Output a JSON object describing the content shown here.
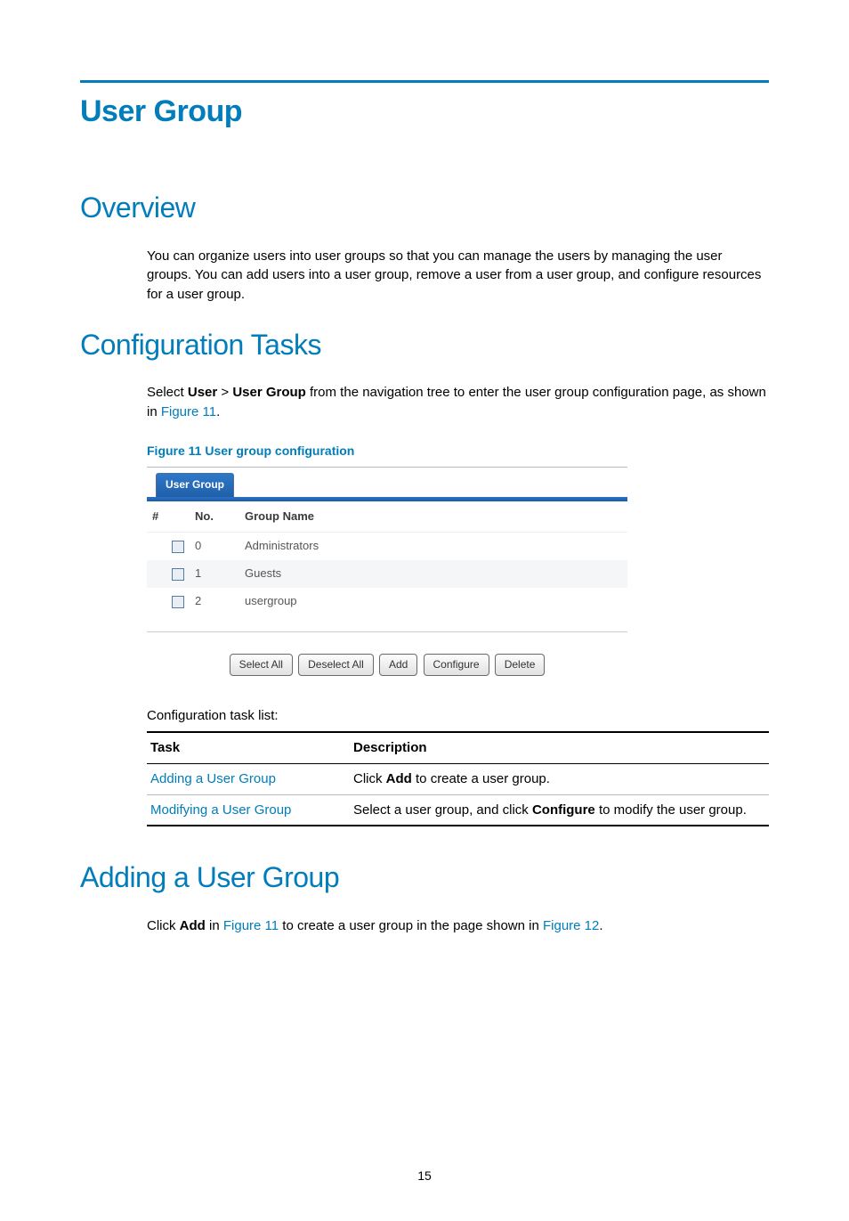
{
  "pageTitle": "User Group",
  "overview": {
    "heading": "Overview",
    "text": "You can organize users into user groups so that you can manage the users by managing the user groups. You can add users into a user group, remove a user from a user group, and configure resources for a user group."
  },
  "config": {
    "heading": "Configuration Tasks",
    "introPre": "Select ",
    "introBold1": "User",
    "introGt": " > ",
    "introBold2": "User Group",
    "introMid": " from the navigation tree to enter the user group configuration page, as shown in ",
    "introLink": "Figure 11",
    "introEnd": ".",
    "figureCaption": "Figure 11 User group configuration",
    "tabLabel": "User Group",
    "columns": {
      "hash": "#",
      "no": "No.",
      "name": "Group Name"
    },
    "rows": [
      {
        "no": "0",
        "name": "Administrators"
      },
      {
        "no": "1",
        "name": "Guests"
      },
      {
        "no": "2",
        "name": "usergroup"
      }
    ],
    "buttons": {
      "selectAll": "Select All",
      "deselectAll": "Deselect All",
      "add": "Add",
      "configure": "Configure",
      "delete": "Delete"
    },
    "taskListLabel": "Configuration task list:",
    "taskHeaders": {
      "task": "Task",
      "desc": "Description"
    },
    "tasks": [
      {
        "task": "Adding a User Group",
        "descPre": "Click ",
        "descBold": "Add",
        "descPost": " to create a user group."
      },
      {
        "task": "Modifying a User Group",
        "descPre": "Select a user group, and click ",
        "descBold": "Configure",
        "descPost": " to modify the user group."
      }
    ]
  },
  "adding": {
    "heading": "Adding a User Group",
    "pre": "Click ",
    "bold": "Add",
    "mid1": " in ",
    "link1": "Figure 11",
    "mid2": " to create a user group in the page shown in ",
    "link2": "Figure 12",
    "end": "."
  },
  "pageNumber": "15"
}
